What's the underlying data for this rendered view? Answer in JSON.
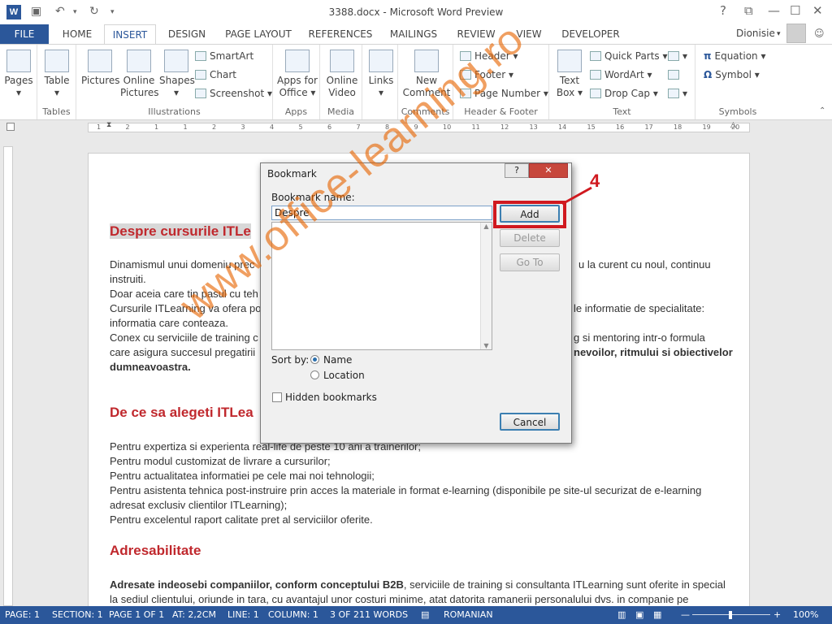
{
  "window": {
    "title": "3388.docx - Microsoft Word Preview",
    "app_icon": "W"
  },
  "qat": {
    "save_icon": "save-icon",
    "undo_icon": "undo-icon",
    "redo_icon": "redo-icon"
  },
  "window_buttons": {
    "help": "?",
    "restore_ribbon": "⧉",
    "minimize": "—",
    "maximize": "☐",
    "close": "✕"
  },
  "tabs": [
    "FILE",
    "HOME",
    "INSERT",
    "DESIGN",
    "PAGE LAYOUT",
    "REFERENCES",
    "MAILINGS",
    "REVIEW",
    "VIEW",
    "DEVELOPER"
  ],
  "user": {
    "name": "Dionisie"
  },
  "ribbon": {
    "pages": "Pages",
    "table": "Table",
    "pictures": "Pictures",
    "online_pictures": "Online Pictures",
    "shapes": "Shapes",
    "smartart": "SmartArt",
    "chart": "Chart",
    "screenshot": "Screenshot",
    "apps_for_office": "Apps for Office",
    "online_video": "Online Video",
    "links": "Links",
    "new_comment": "New Comment",
    "header": "Header",
    "footer": "Footer",
    "page_number": "Page Number",
    "text_box": "Text Box",
    "quick_parts": "Quick Parts",
    "wordart": "WordArt",
    "drop_cap": "Drop Cap",
    "equation": "Equation",
    "symbol": "Symbol",
    "groups": {
      "tables": "Tables",
      "illustrations": "Illustrations",
      "apps": "Apps",
      "media": "Media",
      "comments": "Comments",
      "header_footer": "Header & Footer",
      "text": "Text",
      "symbols": "Symbols"
    }
  },
  "ruler": [
    "1",
    "2",
    "1",
    "1",
    "2",
    "3",
    "4",
    "5",
    "6",
    "7",
    "8",
    "9",
    "10",
    "11",
    "12",
    "13",
    "14",
    "15",
    "16",
    "17",
    "18",
    "19",
    "20"
  ],
  "document": {
    "h1": "Despre cursurile ITLe",
    "p1a": "Dinamismul unui domeniu prec",
    "p1b": "u la curent cu noul, continuu",
    "p2": "instruiti.",
    "p3": "Doar aceia care tin pasul cu teh",
    "p4a": "Cursurile ITLearning va ofera po",
    "p4b": "le informatie de specialitate:",
    "p5": "informatia care conteaza.",
    "p6a": "Conex cu serviciile de training c",
    "p6b": "g si mentoring intr-o formula",
    "p7a": "care asigura succesul pregatirii",
    "p7b": "nevoilor, ritmului si obiectivelor",
    "p8": "dumneavoastra.",
    "h2": "De ce sa alegeti ITLea",
    "l1": "Pentru expertiza si experienta real-life de peste 10 ani a trainerilor;",
    "l2": "Pentru modul customizat de livrare a cursurilor;",
    "l3": "Pentru actualitatea informatiei pe cele mai noi tehnologii;",
    "l4": "Pentru asistenta tehnica post-instruire prin acces la materiale in format e-learning (disponibile pe site-ul securizat de e-learning",
    "l5": "adresat exclusiv clientilor ITLearning);",
    "l6": "Pentru excelentul raport calitate pret al serviciilor oferite.",
    "h3": "Adresabilitate",
    "b1": "Adresate indeosebi companiilor, conform conceptului B2B",
    "b1b": ", serviciile de training si consultanta ITLearning sunt oferite in special",
    "b2": "la sediul clientului, oriunde in tara, cu avantajul unor costuri minime, atat datorita ramanerii personalului dvs. in companie pe"
  },
  "watermark": "www.office-learning.ro",
  "dialog": {
    "title": "Bookmark",
    "help": "?",
    "close": "✕",
    "name_label": "Bookmark name:",
    "name_value": "Despre",
    "add": "Add",
    "delete": "Delete",
    "goto": "Go To",
    "sort_by": "Sort by:",
    "sort_name": "Name",
    "sort_location": "Location",
    "hidden": "Hidden bookmarks",
    "cancel": "Cancel"
  },
  "callout": {
    "number": "4",
    "color": "#d0191f"
  },
  "status": {
    "page": "PAGE: 1",
    "section": "SECTION: 1",
    "pageof": "PAGE 1 OF 1",
    "at": "AT: 2,2CM",
    "line": "LINE: 1",
    "column": "COLUMN: 1",
    "words": "3 OF 211 WORDS",
    "language": "ROMANIAN",
    "zoom": "100%"
  },
  "colors": {
    "accent": "#2b579a",
    "heading": "#c0282d"
  }
}
